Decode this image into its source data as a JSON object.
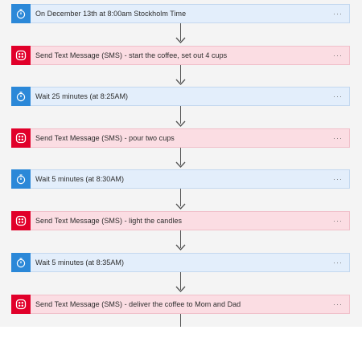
{
  "steps": [
    {
      "type": "timer",
      "icon": "stopwatch-icon",
      "label": "On December 13th at 8:00am Stockholm Time",
      "menu": "···"
    },
    {
      "type": "sms",
      "icon": "sms-icon",
      "label": "Send Text Message (SMS) - start the coffee, set out 4 cups",
      "menu": "···"
    },
    {
      "type": "timer",
      "icon": "stopwatch-icon",
      "label": "Wait 25 minutes (at 8:25AM)",
      "menu": "···"
    },
    {
      "type": "sms",
      "icon": "sms-icon",
      "label": "Send Text Message (SMS) - pour two cups",
      "menu": "···"
    },
    {
      "type": "timer",
      "icon": "stopwatch-icon",
      "label": "Wait 5 minutes (at 8:30AM)",
      "menu": "···"
    },
    {
      "type": "sms",
      "icon": "sms-icon",
      "label": "Send Text Message (SMS) - light the candles",
      "menu": "···"
    },
    {
      "type": "timer",
      "icon": "stopwatch-icon",
      "label": "Wait 5 minutes (at 8:35AM)",
      "menu": "···"
    },
    {
      "type": "sms",
      "icon": "sms-icon",
      "label": "Send Text Message (SMS) - deliver the coffee to Mom and Dad",
      "menu": "···"
    }
  ],
  "colors": {
    "timer_fill": "#e3eefb",
    "timer_icon": "#2b88d8",
    "sms_fill": "#fbdde3",
    "sms_icon": "#e1002a",
    "connector": "#555555"
  }
}
